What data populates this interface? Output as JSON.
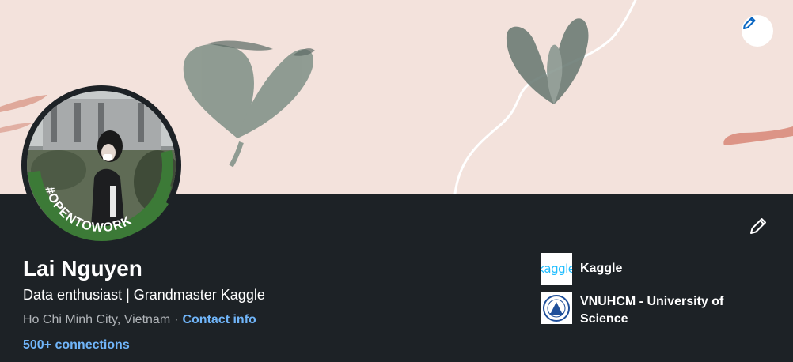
{
  "profile": {
    "name": "Lai Nguyen",
    "headline": "Data enthusiast | Grandmaster Kaggle",
    "location": "Ho Chi Minh City, Vietnam",
    "separator": "·",
    "contact_info": "Contact info",
    "connections": "500+ connections",
    "open_to_work_badge": "#OPENTOWORK"
  },
  "organizations": [
    {
      "name": "Kaggle",
      "logo_text": "kaggle",
      "logo_icon": "kaggle-logo"
    },
    {
      "name": "VNUHCM - University of Science",
      "logo_icon": "university-crest"
    }
  ],
  "icons": {
    "banner_edit": "pencil-icon",
    "profile_edit": "pencil-icon"
  },
  "colors": {
    "page_background": "#1d2226",
    "banner_background": "#f3e2dc",
    "link": "#70b5f9",
    "open_to_work_green": "#3c7a37",
    "edit_icon_blue": "#0a66c2"
  }
}
